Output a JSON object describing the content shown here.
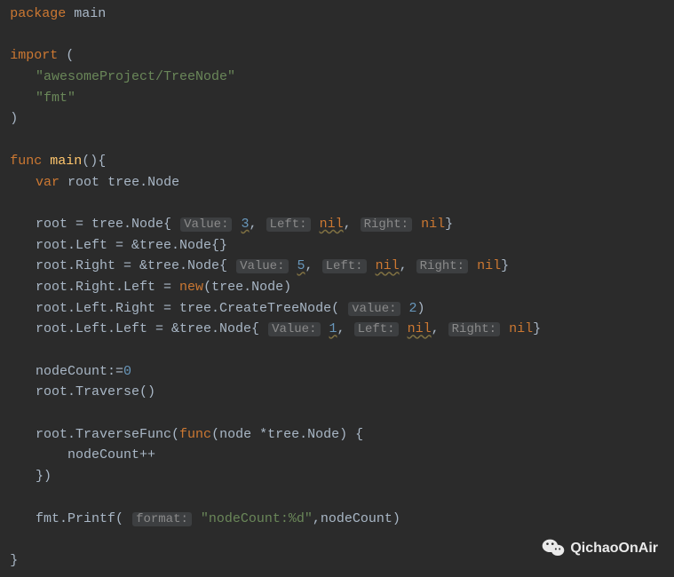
{
  "lines": {
    "l1_package": "package",
    "l1_main": "main",
    "l2_import": "import",
    "l2_paren": "(",
    "l3_imp1": "\"awesomeProject/TreeNode\"",
    "l4_imp2": "\"fmt\"",
    "l5_paren": ")",
    "l6_func": "func",
    "l6_main": "main",
    "l6_rest": "(){",
    "l7_var": "var",
    "l7_root": "root",
    "l7_type": "tree.Node",
    "l8_root": "root = tree.Node{",
    "l8_hint_value": "Value:",
    "l8_val": "3",
    "l8_comma1": ",",
    "l8_hint_left": "Left:",
    "l8_nil1": "nil",
    "l8_comma2": ",",
    "l8_hint_right": "Right:",
    "l8_nil2": "nil",
    "l8_end": "}",
    "l9": "root.Left = &tree.Node{}",
    "l10_a": "root.Right = &tree.Node{",
    "l10_hint_value": "Value:",
    "l10_val": "5",
    "l10_c1": ",",
    "l10_hint_left": "Left:",
    "l10_nil1": "nil",
    "l10_c2": ",",
    "l10_hint_right": "Right:",
    "l10_nil2": "nil",
    "l10_end": "}",
    "l11_a": "root.Right.Left = ",
    "l11_new": "new",
    "l11_b": "(tree.Node)",
    "l12_a": "root.Left.Right = tree.CreateTreeNode(",
    "l12_hint_value": "value:",
    "l12_val": "2",
    "l12_end": ")",
    "l13_a": "root.Left.Left = &tree.Node{",
    "l13_hint_value": "Value:",
    "l13_val": "1",
    "l13_c1": ",",
    "l13_hint_left": "Left:",
    "l13_nil1": "nil",
    "l13_c2": ",",
    "l13_hint_right": "Right:",
    "l13_nil2": "nil",
    "l13_end": "}",
    "l14_a": "nodeCount:=",
    "l14_val": "0",
    "l15": "root.Traverse()",
    "l16_a": "root.TraverseFunc(",
    "l16_func": "func",
    "l16_b": "(node *tree.Node) {",
    "l17": "nodeCount++",
    "l18": "})",
    "l19_a": "fmt.Printf(",
    "l19_hint_format": "format:",
    "l19_str": "\"nodeCount:%d\"",
    "l19_b": ",nodeCount)",
    "l20": "}"
  },
  "watermark": "QichaoOnAir"
}
